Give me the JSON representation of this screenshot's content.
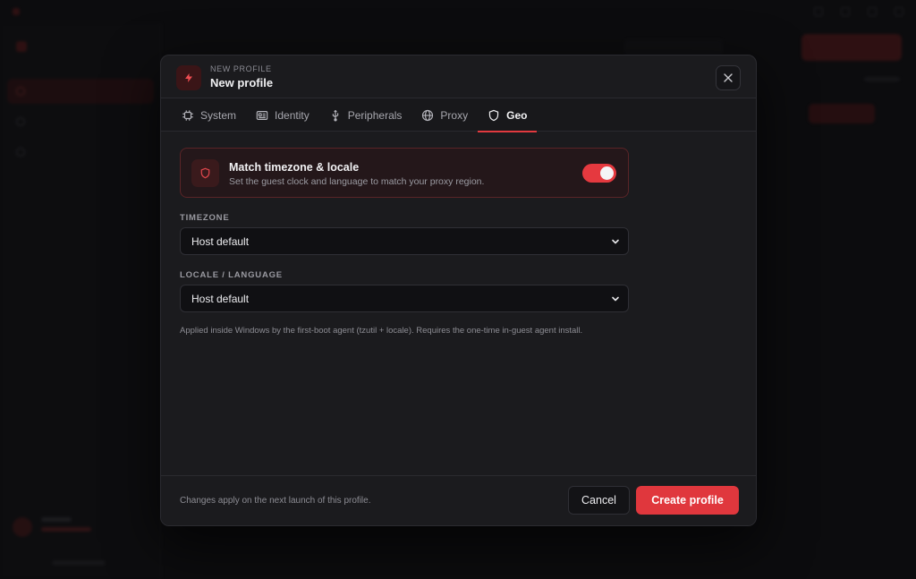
{
  "modal": {
    "eyebrow": "NEW PROFILE",
    "title": "New profile"
  },
  "tabs": [
    {
      "label": "System",
      "icon": "chip-icon",
      "active": false
    },
    {
      "label": "Identity",
      "icon": "id-card-icon",
      "active": false
    },
    {
      "label": "Peripherals",
      "icon": "usb-icon",
      "active": false
    },
    {
      "label": "Proxy",
      "icon": "globe-icon",
      "active": false
    },
    {
      "label": "Geo",
      "icon": "shield-icon",
      "active": true
    }
  ],
  "geo": {
    "match_title": "Match timezone & locale",
    "match_subtitle": "Set the guest clock and language to match your proxy region.",
    "match_enabled": true,
    "timezone_label": "TIMEZONE",
    "timezone_value": "Host default",
    "locale_label": "LOCALE / LANGUAGE",
    "locale_value": "Host default",
    "note": "Applied inside Windows by the first-boot agent (tzutil + locale). Requires the one-time in-guest agent install."
  },
  "footer": {
    "note": "Changes apply on the next launch of this profile.",
    "cancel_label": "Cancel",
    "create_label": "Create profile"
  },
  "colors": {
    "accent": "#e0373d",
    "modal_bg": "#1b1b1e",
    "page_bg": "#0c0c0e"
  }
}
